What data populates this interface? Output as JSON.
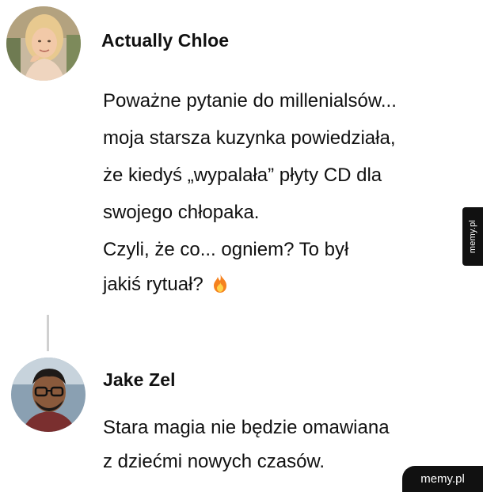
{
  "post1": {
    "author": "Actually Chloe",
    "lines": [
      "Poważne pytanie do millenialsów...",
      "moja starsza kuzynka powiedziała,",
      "że kiedyś „wypalała” płyty CD dla",
      "swojego chłopaka.",
      "Czyli, że co... ogniem? To był",
      "jakiś rytuał?"
    ],
    "emoji": "fire-icon"
  },
  "post2": {
    "author": "Jake Zel",
    "lines": [
      "Stara magia nie będzie omawiana",
      "z dziećmi nowych czasów."
    ]
  },
  "watermarks": {
    "side": "memy.pl",
    "corner": "memy.pl"
  }
}
